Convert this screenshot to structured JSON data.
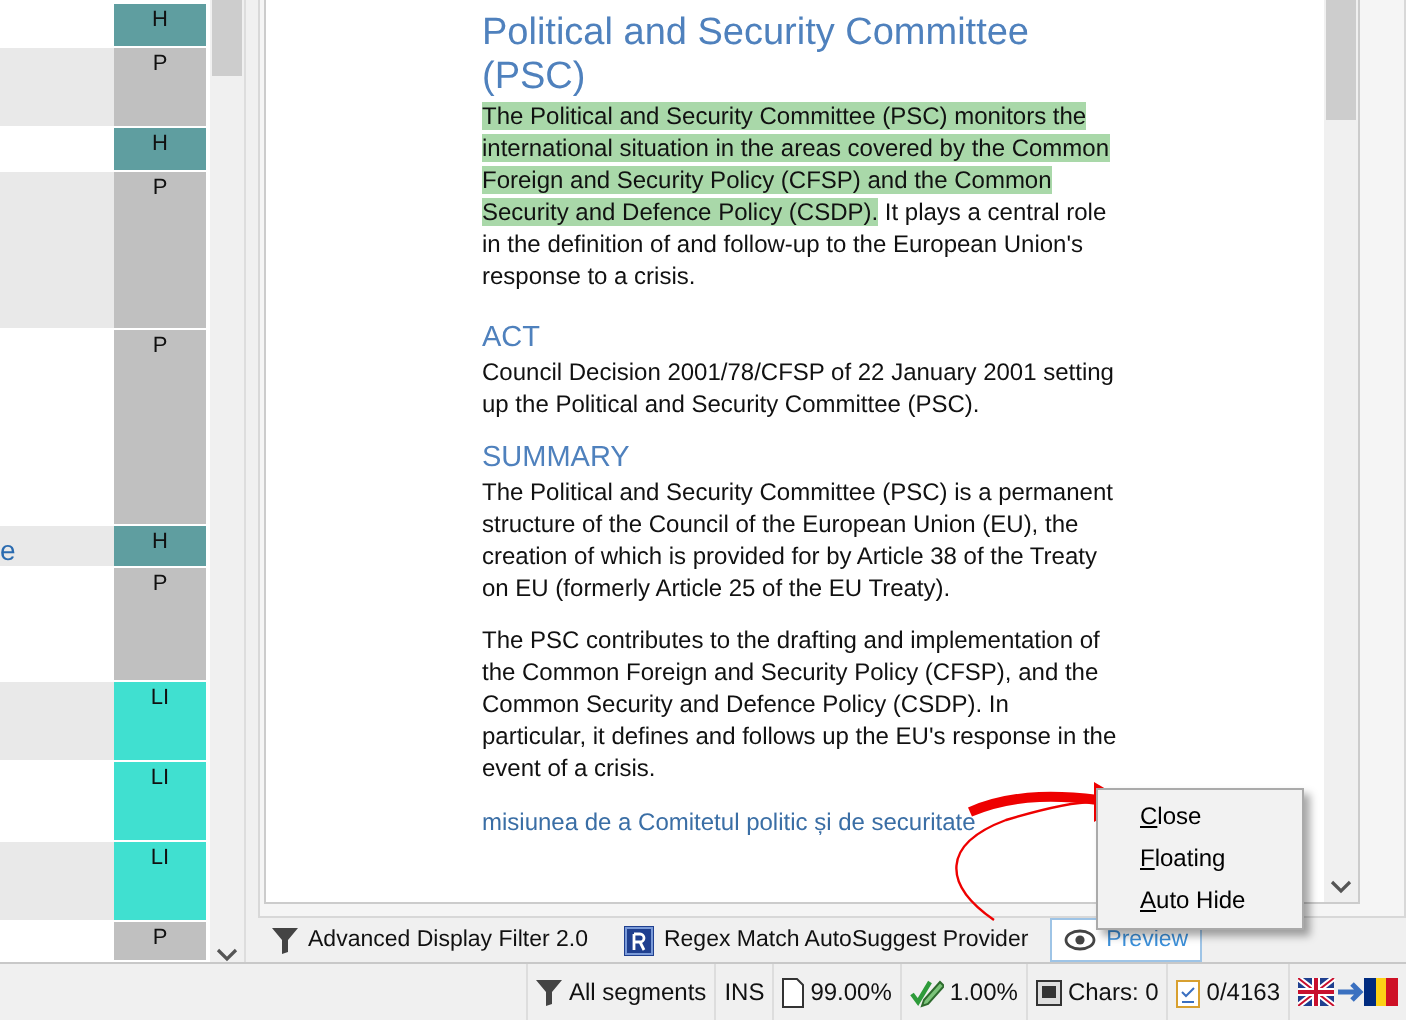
{
  "segments": [
    {
      "tag": "H",
      "color": "#5f9ea0"
    },
    {
      "tag": "P",
      "color": "#c0c0c0"
    },
    {
      "tag": "H",
      "color": "#5f9ea0"
    },
    {
      "tag": "P",
      "color": "#c0c0c0"
    },
    {
      "tag": "P",
      "color": "#c0c0c0"
    },
    {
      "tag": "H",
      "color": "#5f9ea0",
      "text": "e"
    },
    {
      "tag": "P",
      "color": "#c0c0c0"
    },
    {
      "tag": "LI",
      "color": "#40e0d0"
    },
    {
      "tag": "LI",
      "color": "#40e0d0"
    },
    {
      "tag": "LI",
      "color": "#40e0d0"
    },
    {
      "tag": "P",
      "color": "#c0c0c0"
    }
  ],
  "preview": {
    "title": "Political and Security Committee (PSC)",
    "blocks": [
      {
        "kind": "paragraph",
        "highlight": "The Political and Security Committee (PSC) monitors the international situation in the areas covered by the Common Foreign and Security Policy (CFSP) and the Common Security and Defence Policy (CSDP).",
        "text": " It plays a central role in the definition of and follow-up to the European Union's response to a crisis."
      },
      {
        "kind": "heading",
        "text": "ACT"
      },
      {
        "kind": "paragraph",
        "text": "Council Decision 2001/78/CFSP of 22 January 2001 setting up the Political and Security Committee (PSC)."
      },
      {
        "kind": "heading",
        "text": "SUMMARY"
      },
      {
        "kind": "paragraph",
        "text": "The Political and Security Committee (PSC) is a permanent structure of the Council of the European Union (EU), the creation of which is provided for by Article 38 of the Treaty on EU (formerly Article 25 of the EU Treaty)."
      },
      {
        "kind": "paragraph",
        "text": "The PSC contributes to the drafting and implementation of the Common Foreign and Security Policy (CFSP), and the Common Security and Defence Policy (CSDP). In particular, it defines and follows up the EU's response in the event of a crisis."
      },
      {
        "kind": "translation",
        "text": "misiunea de a Comitetul politic și de securitate"
      }
    ]
  },
  "tabs": [
    {
      "label": "Advanced Display Filter 2.0",
      "selected": false
    },
    {
      "label": "Regex Match AutoSuggest Provider",
      "selected": false
    },
    {
      "label": "Preview",
      "selected": true
    }
  ],
  "context_menu": [
    "Close",
    "Floating",
    "Auto Hide"
  ],
  "status_bar": [
    "All segments",
    "INS",
    "99.00%",
    "1.00%",
    "Chars: 0",
    "0/4163"
  ]
}
